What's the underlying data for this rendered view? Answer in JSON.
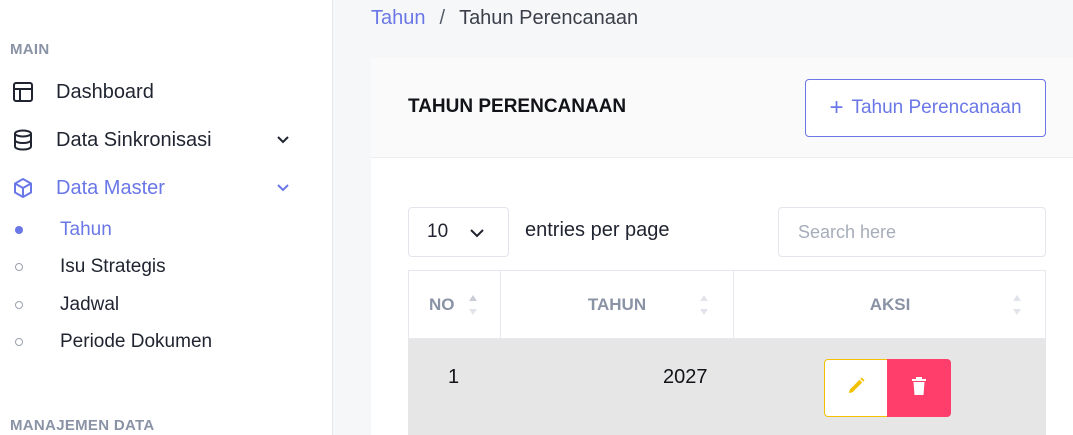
{
  "sidebar": {
    "sections": {
      "main": "MAIN",
      "manajemen": "MANAJEMEN DATA"
    },
    "items": [
      {
        "label": "Dashboard",
        "icon": "layout-icon"
      },
      {
        "label": "Data Sinkronisasi",
        "icon": "database-icon"
      },
      {
        "label": "Data Master",
        "icon": "cube-icon"
      }
    ],
    "sub_items": [
      {
        "label": "Tahun",
        "active": true
      },
      {
        "label": "Isu Strategis",
        "active": false
      },
      {
        "label": "Jadwal",
        "active": false
      },
      {
        "label": "Periode Dokumen",
        "active": false
      }
    ]
  },
  "breadcrumb": {
    "link": "Tahun",
    "separator": "/",
    "current": "Tahun Perencanaan"
  },
  "card": {
    "title": "TAHUN PERENCANAAN",
    "add_button": "Tahun Perencanaan",
    "add_button_prefix": "+"
  },
  "table_controls": {
    "entries_value": "10",
    "entries_label": "entries per page",
    "search_placeholder": "Search here"
  },
  "table": {
    "columns": [
      "NO",
      "TAHUN",
      "AKSI"
    ],
    "rows": [
      {
        "no": "1",
        "tahun": "2027"
      }
    ]
  },
  "colors": {
    "accent": "#6a77e6",
    "edit": "#f2c200",
    "delete": "#ff3e6c",
    "row_bg": "#e6e6e6"
  }
}
